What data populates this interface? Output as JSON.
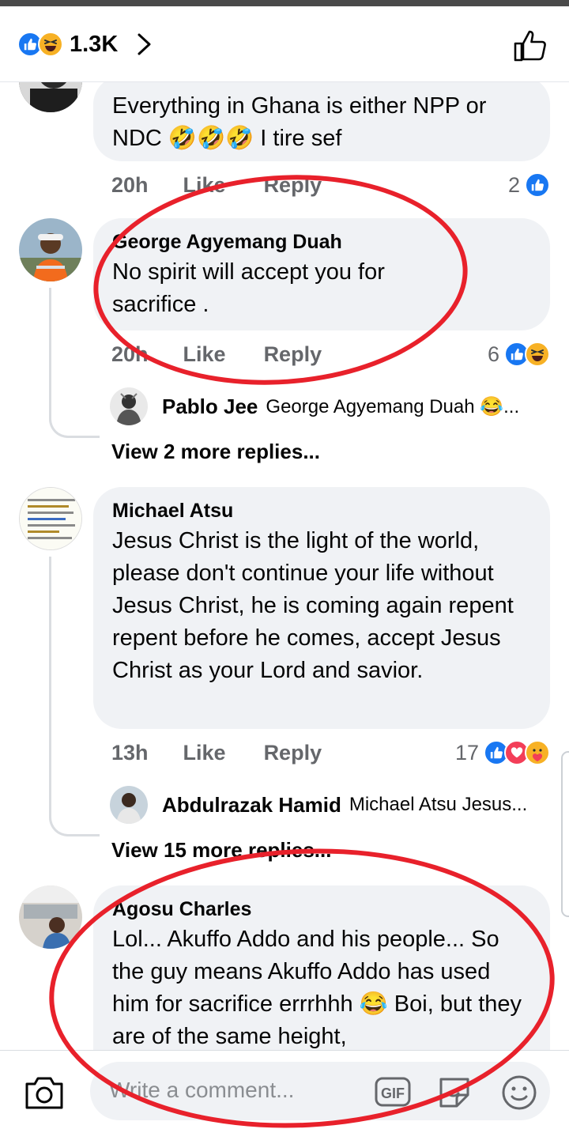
{
  "header": {
    "reaction_count": "1.3K",
    "reaction_icons": [
      "like-icon",
      "haha-icon"
    ]
  },
  "comments": [
    {
      "author": "",
      "text": "Everything in Ghana is either NPP or NDC 🤣🤣🤣 I tire sef",
      "time": "20h",
      "like_label": "Like",
      "reply_label": "Reply",
      "reaction_count": "2",
      "reaction_icons": [
        "like-icon"
      ]
    },
    {
      "author": "George Agyemang Duah",
      "text": "No spirit will accept you for sacrifice .",
      "time": "20h",
      "like_label": "Like",
      "reply_label": "Reply",
      "reaction_count": "6",
      "reaction_icons": [
        "like-icon",
        "haha-icon"
      ],
      "reply_preview": {
        "name": "Pablo Jee",
        "text": "George Agyemang Duah 😂..."
      },
      "more_replies": "View 2 more replies..."
    },
    {
      "author": "Michael Atsu",
      "text": "Jesus Christ is the light of the world, please don't continue your life without Jesus Christ,  he is coming again repent repent before he comes, accept Jesus Christ as your Lord and savior.",
      "time": "13h",
      "like_label": "Like",
      "reply_label": "Reply",
      "reaction_count": "17",
      "reaction_icons": [
        "like-icon",
        "love-icon",
        "care-icon"
      ],
      "reply_preview": {
        "name": "Abdulrazak Hamid",
        "text": "Michael Atsu Jesus..."
      },
      "more_replies": "View 15 more replies..."
    },
    {
      "author": "Agosu Charles",
      "text": "Lol... Akuffo Addo and his people... So the guy means Akuffo Addo has used him for sacrifice errrhhh 😂 Boi, but they are of the same height,"
    }
  ],
  "composer": {
    "placeholder": "Write a comment...",
    "gif_label": "GIF"
  },
  "colors": {
    "accent": "#1877f2",
    "bubble": "#f0f2f5",
    "meta_text": "#65676b",
    "annotation": "#e8212b"
  }
}
